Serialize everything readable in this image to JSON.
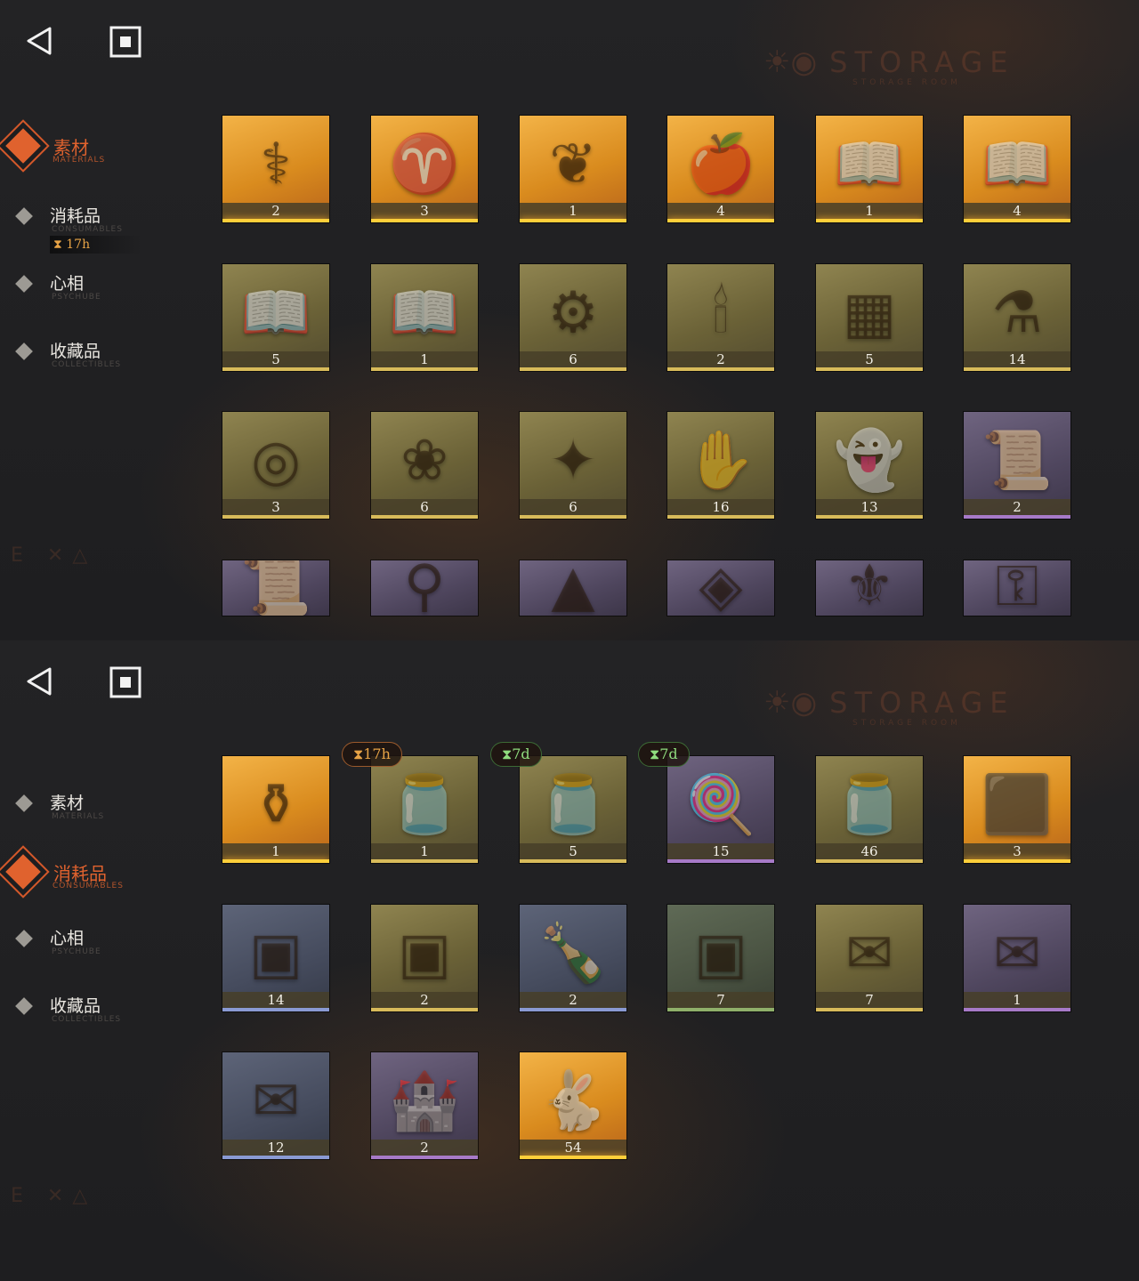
{
  "watermark": {
    "text": "STORAGE",
    "sub": "STORAGE ROOM"
  },
  "corner_mark": "E ✕△",
  "screens": [
    {
      "nav": [
        {
          "label": "素材",
          "sub": "MATERIALS",
          "active": true
        },
        {
          "label": "消耗品",
          "sub": "CONSUMABLES",
          "active": false
        },
        {
          "label": "心相",
          "sub": "PSYCHUBE",
          "active": false
        },
        {
          "label": "收藏品",
          "sub": "COLLECTIBLES",
          "active": false
        }
      ],
      "nav_timer": "⧗ 17h",
      "items": [
        {
          "icon": "caduceus-icon",
          "glyph": "⚕",
          "count": "2",
          "rarity": "gold"
        },
        {
          "icon": "sheep-icon",
          "glyph": "♈",
          "count": "3",
          "rarity": "gold"
        },
        {
          "icon": "laurel-branch-icon",
          "glyph": "❦",
          "count": "1",
          "rarity": "gold"
        },
        {
          "icon": "snake-apple-icon",
          "glyph": "🍎",
          "count": "4",
          "rarity": "gold"
        },
        {
          "icon": "red-rune-book-icon",
          "glyph": "📖",
          "count": "1",
          "rarity": "gold"
        },
        {
          "icon": "green-rune-book-icon",
          "glyph": "📖",
          "count": "4",
          "rarity": "gold"
        },
        {
          "icon": "blue-rune-book-icon",
          "glyph": "📖",
          "count": "5",
          "rarity": "goldpale"
        },
        {
          "icon": "gold-rune-book-icon",
          "glyph": "📖",
          "count": "1",
          "rarity": "goldpale"
        },
        {
          "icon": "astrolabe-icon",
          "glyph": "⚙",
          "count": "6",
          "rarity": "goldpale"
        },
        {
          "icon": "ouija-board-icon",
          "glyph": "🕯",
          "count": "2",
          "rarity": "goldpale"
        },
        {
          "icon": "green-tablet-icon",
          "glyph": "▦",
          "count": "5",
          "rarity": "goldpale"
        },
        {
          "icon": "potion-bottle-icon",
          "glyph": "⚗",
          "count": "14",
          "rarity": "goldpale"
        },
        {
          "icon": "brass-sphere-icon",
          "glyph": "◎",
          "count": "3",
          "rarity": "goldpale"
        },
        {
          "icon": "firefly-icon",
          "glyph": "❀",
          "count": "6",
          "rarity": "goldpale"
        },
        {
          "icon": "leather-tome-icon",
          "glyph": "✦",
          "count": "6",
          "rarity": "goldpale"
        },
        {
          "icon": "hand-box-icon",
          "glyph": "✋",
          "count": "16",
          "rarity": "goldpale"
        },
        {
          "icon": "ghost-icon",
          "glyph": "👻",
          "count": "13",
          "rarity": "goldpale"
        },
        {
          "icon": "green-scroll-icon",
          "glyph": "📜",
          "count": "2",
          "rarity": "purple"
        },
        {
          "icon": "blue-scroll-icon",
          "glyph": "📜",
          "count": "",
          "rarity": "purple"
        },
        {
          "icon": "pendant-chain-icon",
          "glyph": "⚲",
          "count": "",
          "rarity": "purple"
        },
        {
          "icon": "stone-fragment-icon",
          "glyph": "▲",
          "count": "",
          "rarity": "purple"
        },
        {
          "icon": "crystal-case-icon",
          "glyph": "◈",
          "count": "",
          "rarity": "purple"
        },
        {
          "icon": "telescope-icon",
          "glyph": "⚜",
          "count": "",
          "rarity": "purple"
        },
        {
          "icon": "winged-key-icon",
          "glyph": "⚿",
          "count": "",
          "rarity": "purple"
        }
      ]
    },
    {
      "nav": [
        {
          "label": "素材",
          "sub": "MATERIALS",
          "active": false
        },
        {
          "label": "消耗品",
          "sub": "CONSUMABLES",
          "active": true
        },
        {
          "label": "心相",
          "sub": "PSYCHUBE",
          "active": false
        },
        {
          "label": "收藏品",
          "sub": "COLLECTIBLES",
          "active": false
        }
      ],
      "badges": [
        "⧗17h",
        "⧗7d",
        "⧗7d"
      ],
      "items": [
        {
          "icon": "tribal-gourd-icon",
          "glyph": "⚱",
          "count": "1",
          "rarity": "gold"
        },
        {
          "icon": "candy-jar-icon",
          "glyph": "🫙",
          "count": "1",
          "rarity": "goldpale"
        },
        {
          "icon": "candy-jar-icon",
          "glyph": "🫙",
          "count": "5",
          "rarity": "goldpale"
        },
        {
          "icon": "lollipop-icon",
          "glyph": "🍭",
          "count": "15",
          "rarity": "purple"
        },
        {
          "icon": "candy-jar-icon",
          "glyph": "🫙",
          "count": "46",
          "rarity": "goldpale"
        },
        {
          "icon": "rune-cube-icon",
          "glyph": "⬛",
          "count": "3",
          "rarity": "gold"
        },
        {
          "icon": "wooden-crate-icon",
          "glyph": "▣",
          "count": "14",
          "rarity": "blue"
        },
        {
          "icon": "wooden-crate-icon",
          "glyph": "▣",
          "count": "2",
          "rarity": "goldpale"
        },
        {
          "icon": "bottle-icon",
          "glyph": "🍾",
          "count": "2",
          "rarity": "blue"
        },
        {
          "icon": "wooden-crate-icon",
          "glyph": "▣",
          "count": "7",
          "rarity": "green"
        },
        {
          "icon": "parcel-icon",
          "glyph": "✉",
          "count": "7",
          "rarity": "goldpale"
        },
        {
          "icon": "parcel-icon",
          "glyph": "✉",
          "count": "1",
          "rarity": "purple"
        },
        {
          "icon": "parcel-icon",
          "glyph": "✉",
          "count": "12",
          "rarity": "blue"
        },
        {
          "icon": "sand-castle-icon",
          "glyph": "🏰",
          "count": "2",
          "rarity": "purple"
        },
        {
          "icon": "rabbit-box-icon",
          "glyph": "🐇",
          "count": "54",
          "rarity": "gold"
        }
      ]
    }
  ],
  "colors": {
    "accent": "#e0622e",
    "timer": "#e7a346",
    "badge_green": "#8fdc7e"
  }
}
